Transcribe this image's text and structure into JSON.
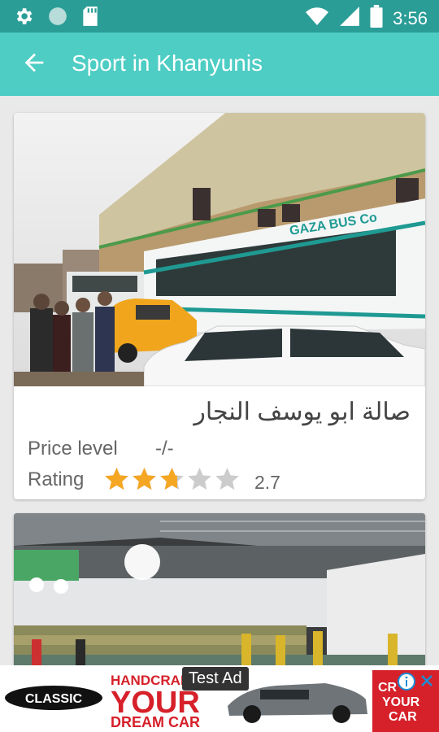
{
  "status_bar": {
    "time": "3:56",
    "icons": [
      "gear-icon",
      "circle-icon",
      "sd-card-icon",
      "wifi-icon",
      "signal-icon",
      "battery-icon"
    ]
  },
  "app_bar": {
    "title": "Sport in Khanyunis",
    "back_icon": "arrow-back-icon"
  },
  "venues": [
    {
      "name": "صالة ابو يوسف النجار",
      "price_label": "Price level",
      "price_value": "-/-",
      "rating_label": "Rating",
      "rating": 2.7,
      "rating_text": "2.7",
      "max_rating": 5,
      "photo": {
        "bus_text": "GAZA BUS Co"
      }
    },
    {
      "photo": {}
    }
  ],
  "ad": {
    "badge": "Test Ad",
    "logo": "CLASSIC",
    "headline_1": "HANDCRAFT",
    "headline_2": "YOUR",
    "headline_3": "DREAM CAR",
    "right_text_1": "CR",
    "right_text_2": "YOUR",
    "right_text_3": "CAR"
  },
  "colors": {
    "status_bar": "#2a9d96",
    "app_bar": "#4ecdc4",
    "star_filled": "#f5a623",
    "star_empty": "#cccccc",
    "ad_red": "#d6202a"
  }
}
